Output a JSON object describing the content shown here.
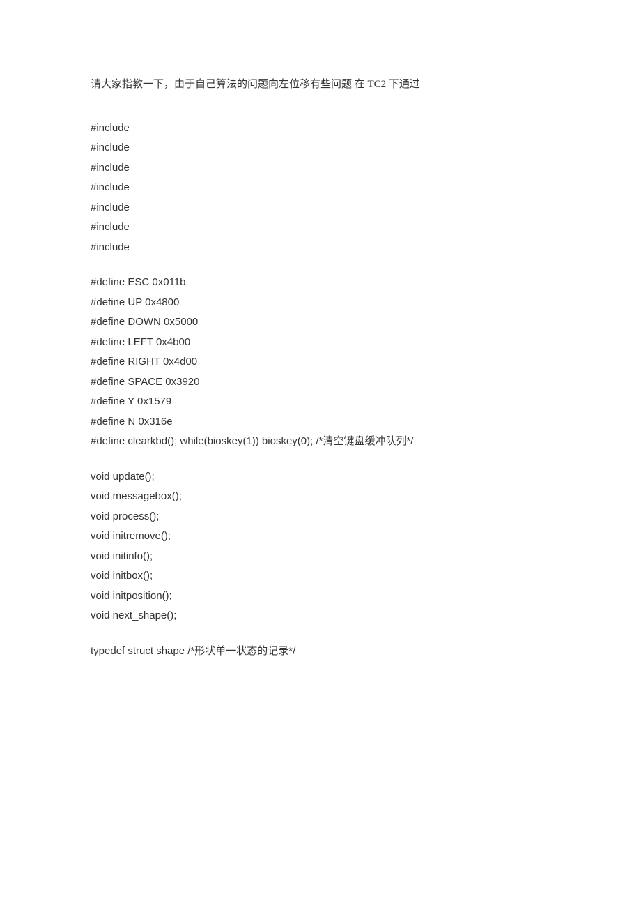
{
  "intro": "请大家指教一下，由于自己算法的问题向左位移有些问题  在 TC2 下通过",
  "includes": [
    "#include",
    "#include",
    "#include",
    "#include",
    "#include",
    "#include",
    "#include"
  ],
  "defines": [
    "#define ESC 0x011b",
    "#define UP 0x4800",
    "#define DOWN 0x5000",
    "#define LEFT 0x4b00",
    "#define RIGHT 0x4d00",
    "#define SPACE 0x3920",
    "#define Y 0x1579",
    "#define N 0x316e",
    "#define clearkbd(); while(bioskey(1)) bioskey(0); /*清空键盘缓冲队列*/"
  ],
  "funcs": [
    "void update();",
    "void messagebox();",
    "void process();",
    "void initremove();",
    "void initinfo();",
    "void initbox();",
    "void initposition();",
    "void next_shape();"
  ],
  "typedef": "typedef struct shape /*形状单一状态的记录*/"
}
